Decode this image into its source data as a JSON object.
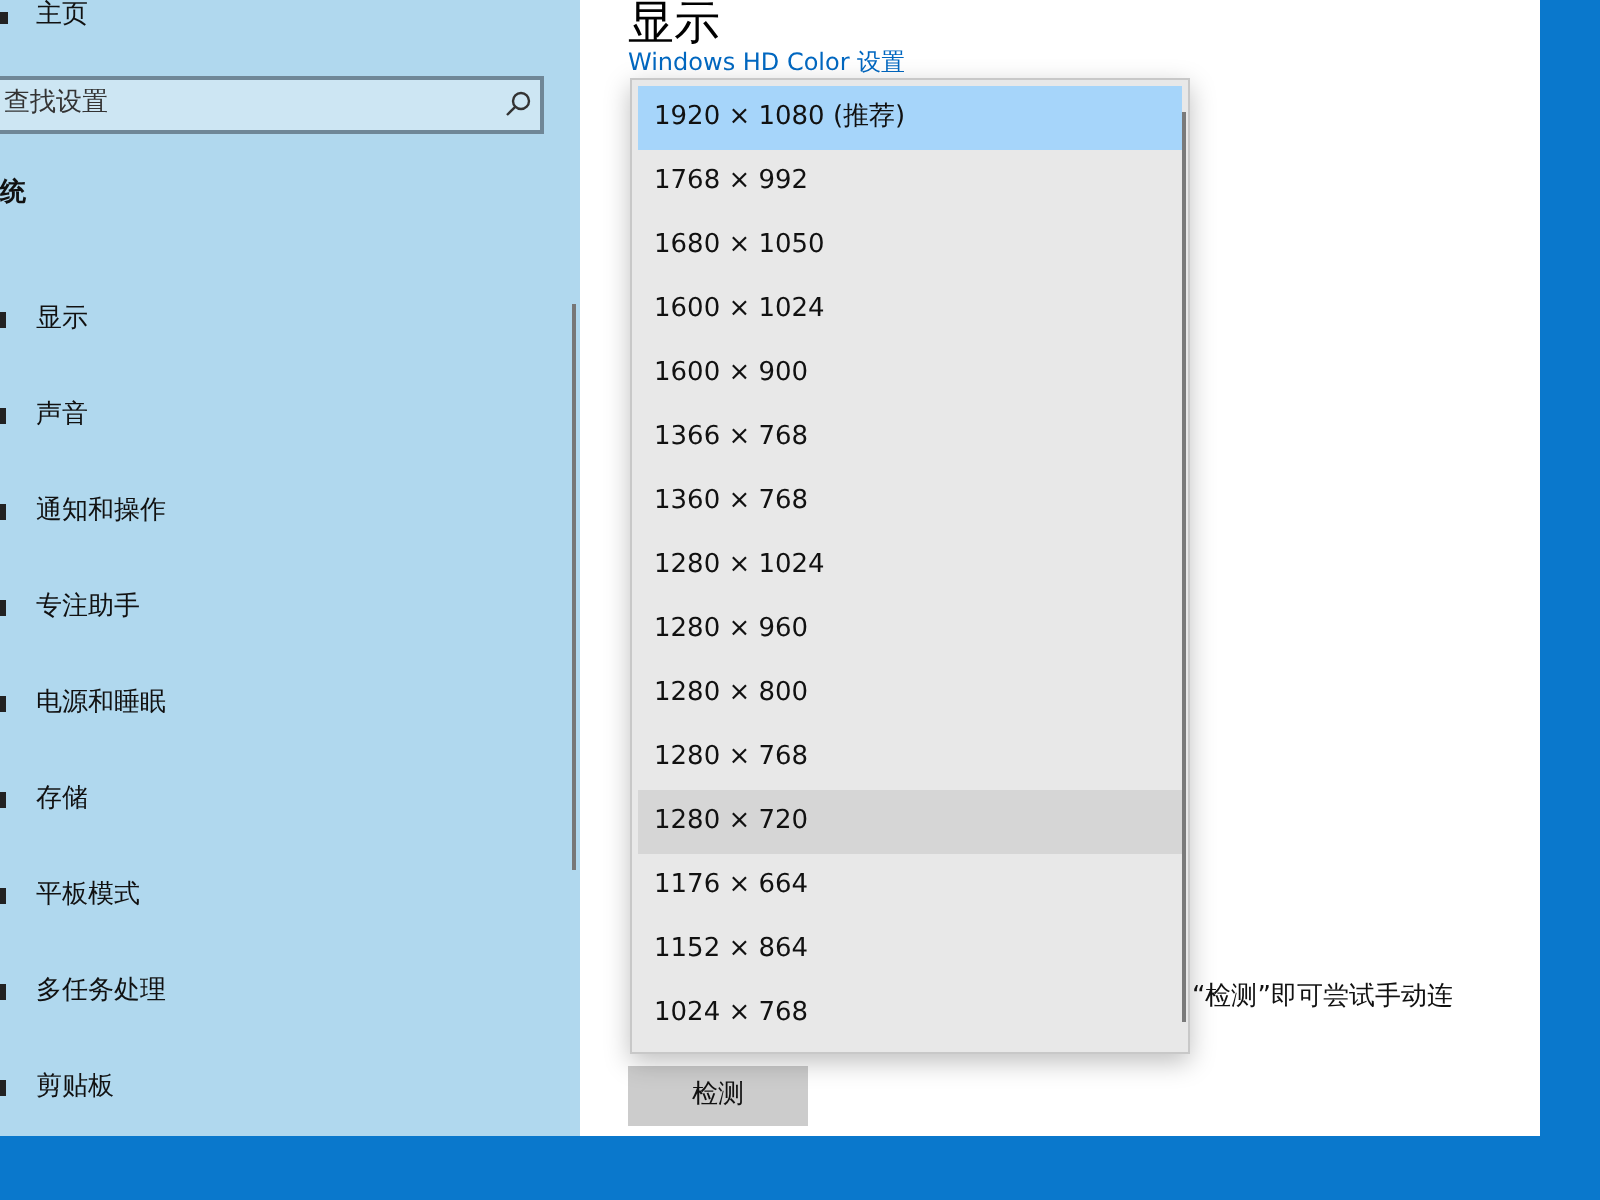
{
  "sidebar": {
    "home": "主页",
    "search": {
      "placeholder": "查找设置"
    },
    "section": "统",
    "items": [
      {
        "label": "显示"
      },
      {
        "label": "声音"
      },
      {
        "label": "通知和操作"
      },
      {
        "label": "专注助手"
      },
      {
        "label": "电源和睡眠"
      },
      {
        "label": "存储"
      },
      {
        "label": "平板模式"
      },
      {
        "label": "多任务处理"
      },
      {
        "label": "剪贴板"
      }
    ]
  },
  "content": {
    "title": "显示",
    "link": "Windows HD Color 设置",
    "note": "“检测”即可尝试手动连",
    "button": "检测"
  },
  "dropdown": {
    "options": [
      {
        "label": "1920 × 1080 (推荐)",
        "selected": true,
        "hovered": false
      },
      {
        "label": "1768 × 992",
        "selected": false,
        "hovered": false
      },
      {
        "label": "1680 × 1050",
        "selected": false,
        "hovered": false
      },
      {
        "label": "1600 × 1024",
        "selected": false,
        "hovered": false
      },
      {
        "label": "1600 × 900",
        "selected": false,
        "hovered": false
      },
      {
        "label": "1366 × 768",
        "selected": false,
        "hovered": false
      },
      {
        "label": "1360 × 768",
        "selected": false,
        "hovered": false
      },
      {
        "label": "1280 × 1024",
        "selected": false,
        "hovered": false
      },
      {
        "label": "1280 × 960",
        "selected": false,
        "hovered": false
      },
      {
        "label": "1280 × 800",
        "selected": false,
        "hovered": false
      },
      {
        "label": "1280 × 768",
        "selected": false,
        "hovered": false
      },
      {
        "label": "1280 × 720",
        "selected": false,
        "hovered": true
      },
      {
        "label": "1176 × 664",
        "selected": false,
        "hovered": false
      },
      {
        "label": "1152 × 864",
        "selected": false,
        "hovered": false
      },
      {
        "label": "1024 × 768",
        "selected": false,
        "hovered": false
      }
    ]
  }
}
